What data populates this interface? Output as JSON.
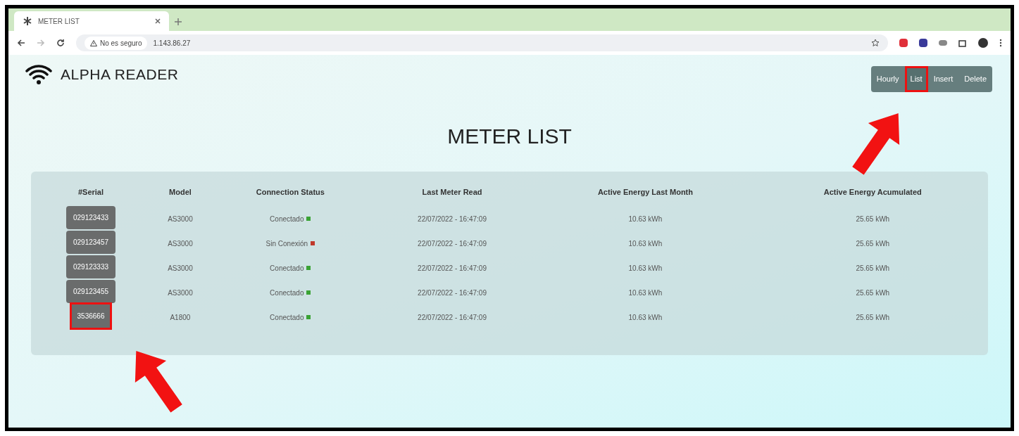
{
  "browser": {
    "tab_title": "METER LIST",
    "security": "No es seguro",
    "url": "1.143.86.27"
  },
  "brand": "ALPHA READER",
  "nav": [
    {
      "label": "Hourly",
      "selected": false,
      "highlighted": false
    },
    {
      "label": "List",
      "selected": true,
      "highlighted": true
    },
    {
      "label": "Insert",
      "selected": false,
      "highlighted": false
    },
    {
      "label": "Delete",
      "selected": false,
      "highlighted": false
    }
  ],
  "title": "METER LIST",
  "table": {
    "columns": [
      "#Serial",
      "Model",
      "Connection Status",
      "Last Meter Read",
      "Active Energy Last Month",
      "Active Energy Acumulated"
    ],
    "rows": [
      {
        "serial": "029123433",
        "highlighted": false,
        "model": "AS3000",
        "status": "Conectado",
        "color": "#3aa335",
        "last_read": "22/07/2022 - 16:47:09",
        "last_month": "10.63 kWh",
        "accumulated": "25.65 kWh"
      },
      {
        "serial": "029123457",
        "highlighted": false,
        "model": "AS3000",
        "status": "Sin Conexión",
        "color": "#c0392b",
        "last_read": "22/07/2022 - 16:47:09",
        "last_month": "10.63 kWh",
        "accumulated": "25.65 kWh"
      },
      {
        "serial": "029123333",
        "highlighted": false,
        "model": "AS3000",
        "status": "Conectado",
        "color": "#3aa335",
        "last_read": "22/07/2022 - 16:47:09",
        "last_month": "10.63 kWh",
        "accumulated": "25.65 kWh"
      },
      {
        "serial": "029123455",
        "highlighted": false,
        "model": "AS3000",
        "status": "Conectado",
        "color": "#3aa335",
        "last_read": "22/07/2022 - 16:47:09",
        "last_month": "10.63 kWh",
        "accumulated": "25.65 kWh"
      },
      {
        "serial": "3536666",
        "highlighted": true,
        "model": "A1800",
        "status": "Conectado",
        "color": "#3aa335",
        "last_read": "22/07/2022 - 16:47:09",
        "last_month": "10.63 kWh",
        "accumulated": "25.65 kWh"
      }
    ]
  }
}
